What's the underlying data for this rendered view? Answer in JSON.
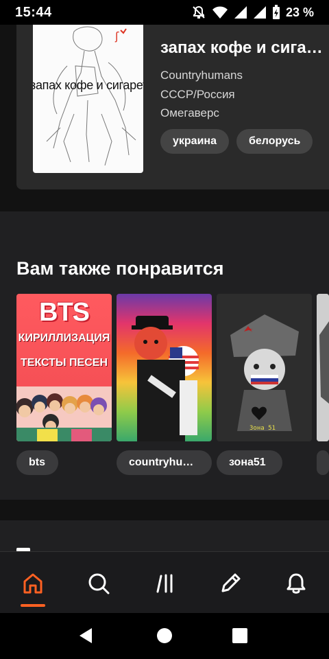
{
  "status_bar": {
    "time": "15:44",
    "battery": "23 %"
  },
  "story": {
    "title": "запах кофе и сигарет",
    "cover_text": "запах кофе и сигарет",
    "fandom": "Countryhumans",
    "pairing": "СССР/Россия",
    "genre": "Омегаверс",
    "tags": [
      "украина",
      "белорусь"
    ]
  },
  "recommendations": {
    "title": "Вам также понравится",
    "items": [
      {
        "label": "bts",
        "cover_logo": "BTS",
        "cover_line1": "КИРИЛЛИЗАЦИЯ",
        "cover_line2": "ТЕКСТЫ ПЕСЕН"
      },
      {
        "label": "countryhumans"
      },
      {
        "label": "зона51",
        "cover_text": "Зона 51"
      },
      {
        "label": ""
      }
    ]
  },
  "bottom_nav": {
    "items": [
      {
        "name": "home-icon",
        "active": true
      },
      {
        "name": "search-icon",
        "active": false
      },
      {
        "name": "library-icon",
        "active": false
      },
      {
        "name": "write-icon",
        "active": false
      },
      {
        "name": "notifications-icon",
        "active": false
      }
    ],
    "accent": "#ff6122"
  },
  "colors": {
    "background": "#121212",
    "card": "#2a2a2a",
    "pill": "#444444",
    "accent": "#ff6122"
  }
}
